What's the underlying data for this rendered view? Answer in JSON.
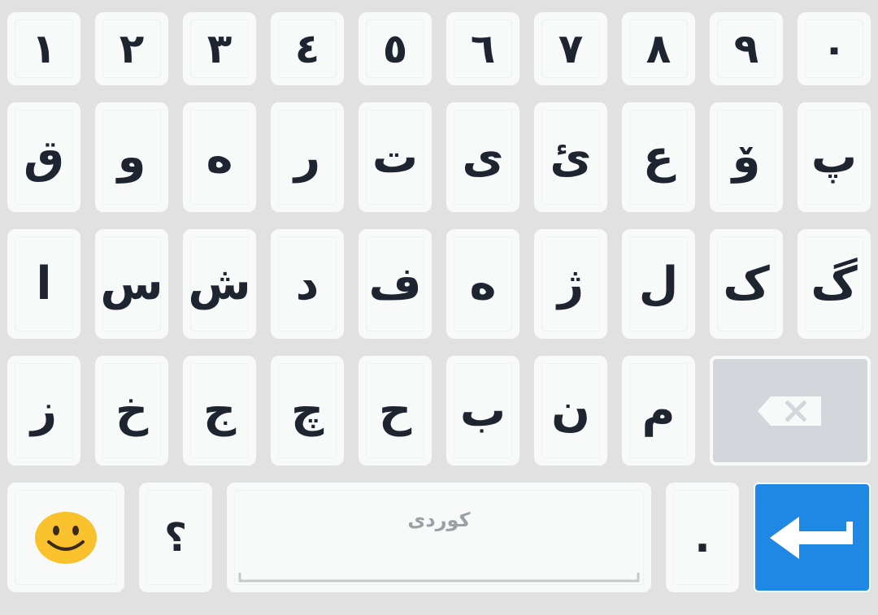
{
  "keyboard": {
    "number_row": [
      "١",
      "٢",
      "٣",
      "٤",
      "٥",
      "٦",
      "٧",
      "٨",
      "٩",
      "٠"
    ],
    "letter_row_1": [
      "ق",
      "و",
      "ە",
      "ر",
      "ت",
      "ی",
      "ئ",
      "ع",
      "ۆ",
      "پ"
    ],
    "letter_row_2": [
      "ا",
      "س",
      "ش",
      "د",
      "ف",
      "ه",
      "ژ",
      "ل",
      "ک",
      "گ"
    ],
    "letter_row_3": [
      "ز",
      "خ",
      "ج",
      "چ",
      "ح",
      "ب",
      "ن",
      "م"
    ],
    "bottom_row": {
      "emoji": "🙂",
      "question_mark": "؟",
      "space_label": "كوردی",
      "period": "."
    }
  },
  "colors": {
    "background": "#e1e1e1",
    "key": "#f8f9f9",
    "key_text": "#1e2530",
    "backspace_key": "#d3d6da",
    "enter_key": "#1f88e5",
    "emoji_face": "#f9c12b"
  },
  "icons": {
    "backspace": "backspace-icon",
    "enter": "enter-arrow-icon",
    "emoji": "smiley-face-icon"
  }
}
